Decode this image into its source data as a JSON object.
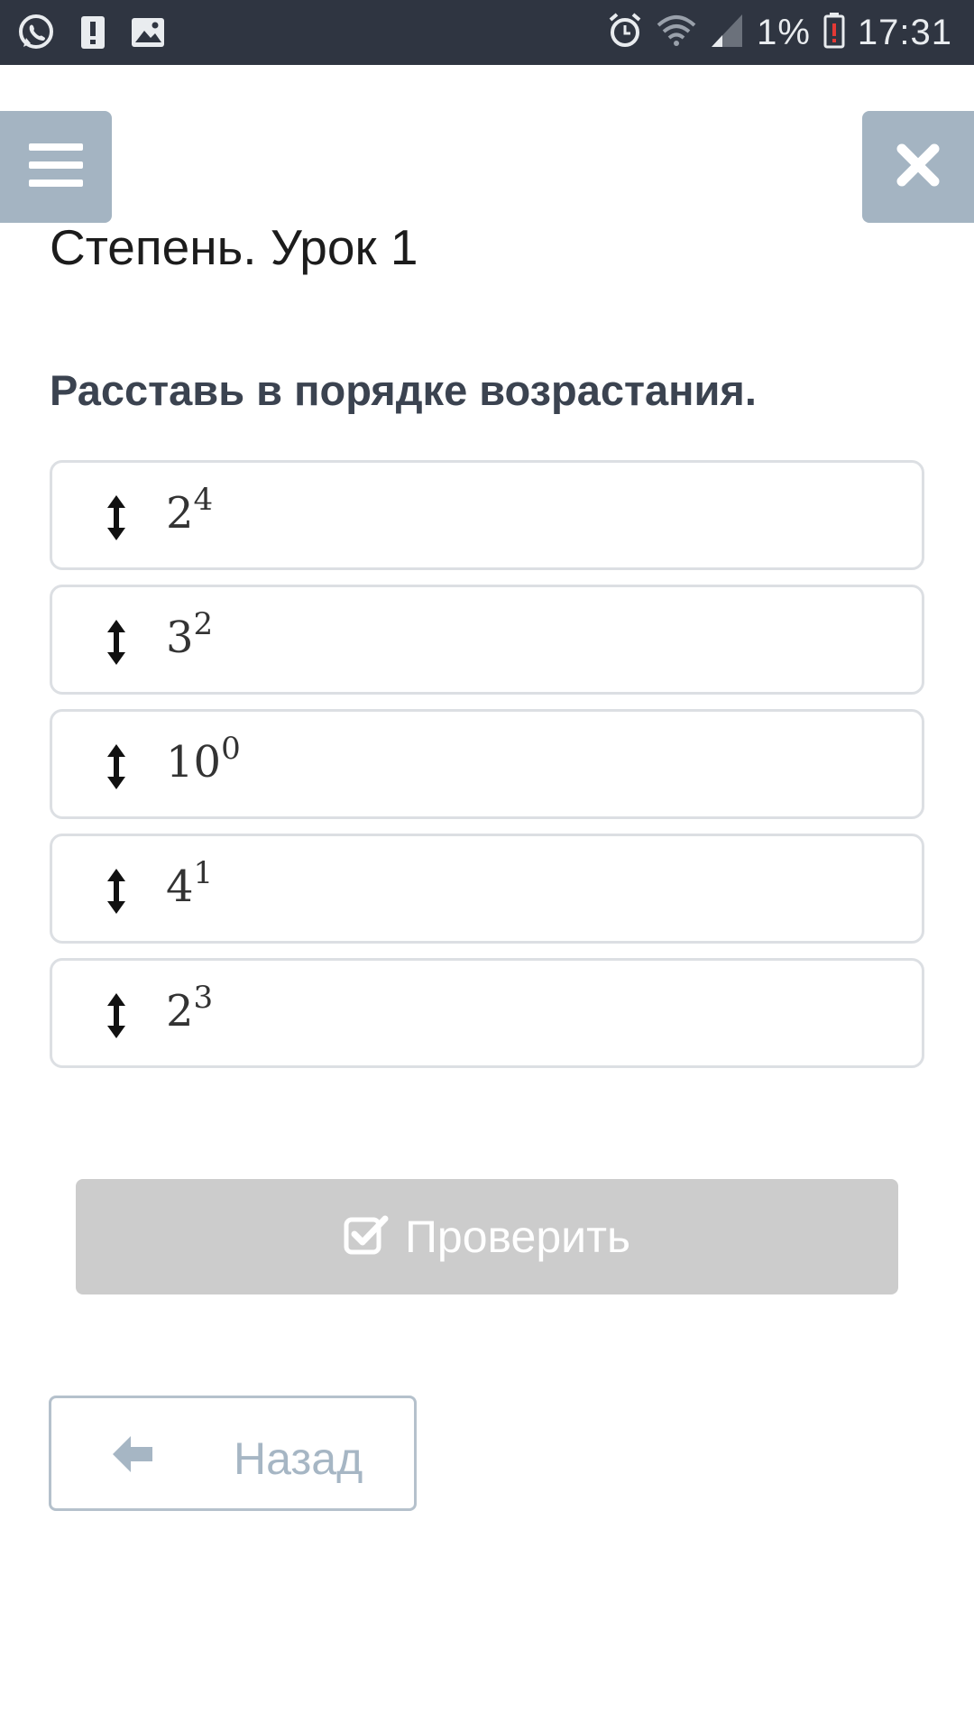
{
  "status_bar": {
    "battery_percent": "1%",
    "time": "17:31",
    "icons": [
      "whatsapp-icon",
      "notification-alert-icon",
      "gallery-icon",
      "alarm-icon",
      "wifi-icon",
      "signal-icon",
      "battery-low-icon"
    ]
  },
  "header": {
    "menu_icon": "hamburger-menu-icon",
    "close_icon": "close-icon"
  },
  "lesson": {
    "title": "Степень. Урок 1"
  },
  "task": {
    "instruction": "Расставь в порядке возрастания.",
    "items": [
      {
        "base": "2",
        "exponent": "4"
      },
      {
        "base": "3",
        "exponent": "2"
      },
      {
        "base": "10",
        "exponent": "0"
      },
      {
        "base": "4",
        "exponent": "1"
      },
      {
        "base": "2",
        "exponent": "3"
      }
    ]
  },
  "actions": {
    "check_label": "Проверить",
    "back_label": "Назад"
  },
  "colors": {
    "status_bar_bg": "#2f3541",
    "nav_button_bg": "#a4b4c2",
    "check_button_bg": "#cccccc",
    "back_button_text": "#a6b6c4"
  }
}
